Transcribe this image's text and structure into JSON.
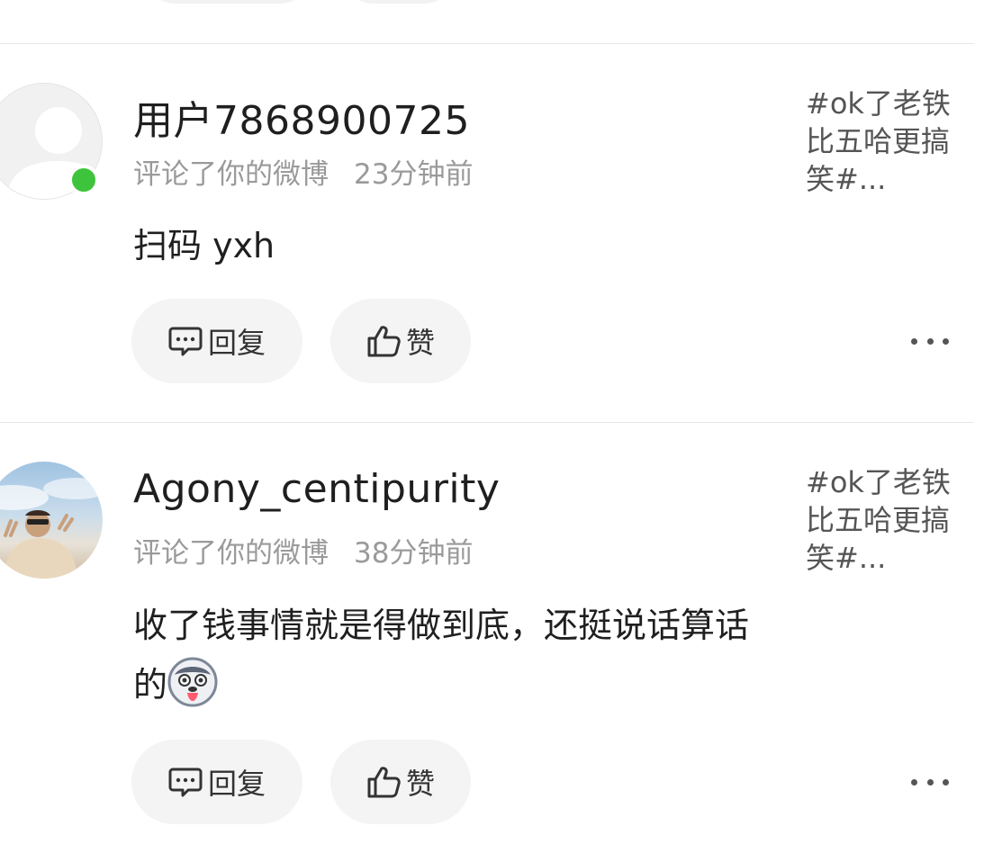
{
  "comments": [
    {
      "username": "用户7868900725",
      "action": "评论了你的微博",
      "time": "23分钟前",
      "content": "扫码 yxh",
      "topic": "#ok了老铁比五哈更搞笑#...",
      "online": true,
      "avatar": "default-avatar",
      "reply_label": "回复",
      "like_label": "赞",
      "more_icon": "ellipsis-icon"
    },
    {
      "username": "Agony_centipurity",
      "action": "评论了你的微博",
      "time": "38分钟前",
      "content": "收了钱事情就是得做到底，还挺说话算话的",
      "emoji": "husky-emoji",
      "topic": "#ok了老铁比五哈更搞笑#...",
      "online": false,
      "avatar": "photo-avatar",
      "reply_label": "回复",
      "like_label": "赞",
      "more_icon": "ellipsis-icon"
    }
  ],
  "colors": {
    "online": "#3ec43c",
    "meta": "#9a9a9a",
    "pill_bg": "#f4f4f4",
    "divider": "#e6e6e6"
  }
}
